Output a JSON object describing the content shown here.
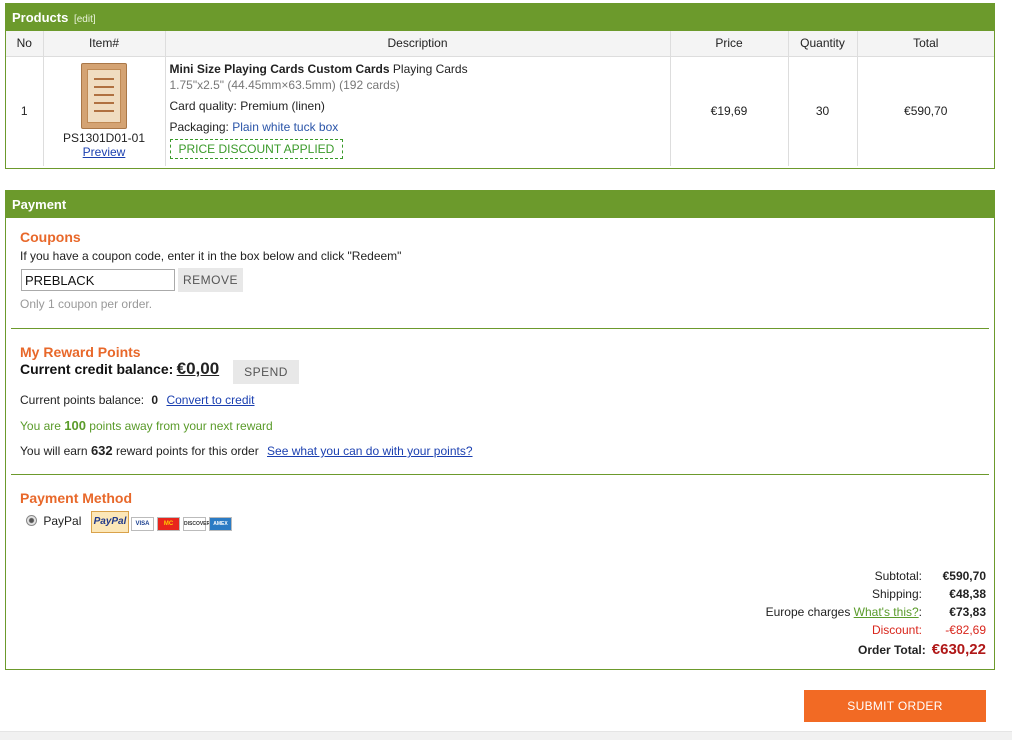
{
  "products": {
    "title": "Products",
    "edit_label": "[edit]",
    "columns": [
      "No",
      "Item#",
      "Description",
      "Price",
      "Quantity",
      "Total"
    ],
    "row": {
      "no": "1",
      "item_code": "PS1301D01-01",
      "preview_label": "Preview",
      "name_bold": "Mini Size Playing Cards Custom Cards",
      "name_rest": " Playing Cards",
      "size": "1.75\"x2.5\" (44.45mm×63.5mm) (192 cards)",
      "quality_label": "Card quality:",
      "quality_value": " Premium (linen)",
      "packaging_label": "Packaging:",
      "packaging_value": " Plain white tuck box",
      "discount_badge": "PRICE DISCOUNT APPLIED",
      "price": "€19,69",
      "quantity": "30",
      "total": "€590,70"
    }
  },
  "payment": {
    "title": "Payment",
    "coupons": {
      "title": "Coupons",
      "instruction": "If you have a coupon code, enter it in the box below and click \"Redeem\"",
      "code": "PREBLACK",
      "remove_label": "REMOVE",
      "note": "Only 1 coupon per order."
    },
    "rewards": {
      "title": "My Reward Points",
      "credit_label": "Current credit balance:",
      "credit_value": "€0,00",
      "spend_label": "SPEND",
      "points_label": "Current points balance:",
      "points_value": "0",
      "convert_label": "Convert to credit",
      "away_prefix": "You are ",
      "away_value": "100",
      "away_suffix": " points away from your next reward",
      "earn_prefix": "You will earn ",
      "earn_value": "632",
      "earn_suffix": " reward points for this order",
      "see_label": "See what you can do with your points?"
    },
    "method": {
      "title": "Payment Method",
      "option_label": "PayPal",
      "logo_text": "PayPal",
      "cards": [
        "VISA",
        "MC",
        "DISCOVER",
        "AMEX"
      ]
    }
  },
  "totals": {
    "subtotal_label": "Subtotal:",
    "subtotal": "€590,70",
    "shipping_label": "Shipping:",
    "shipping": "€48,38",
    "europe_label": "Europe charges ",
    "europe_link": "What's this?",
    "europe_colon": ":",
    "europe": "€73,83",
    "discount_label": "Discount:",
    "discount": "-€82,69",
    "order_total_label": "Order Total:",
    "order_total": "€630,22"
  },
  "submit_label": "SUBMIT ORDER",
  "colors": {
    "brand_green": "#6c9a2c",
    "accent_orange": "#f26a24",
    "title_orange": "#e8682a",
    "discount_red": "#d9261c"
  }
}
